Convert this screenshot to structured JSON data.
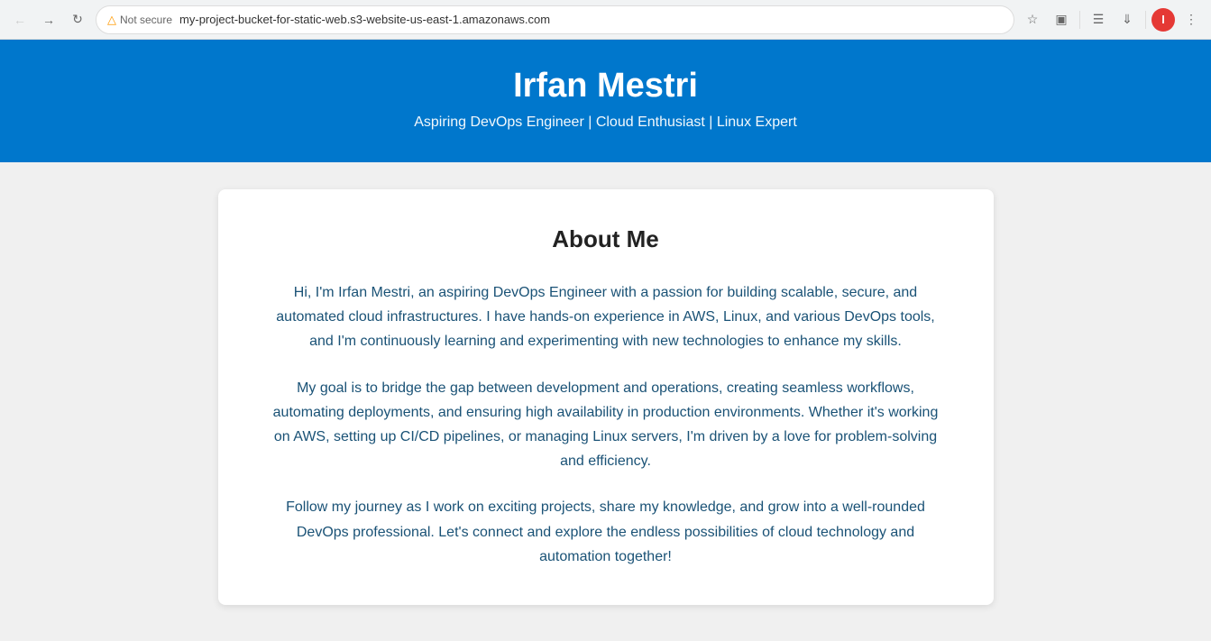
{
  "browser": {
    "not_secure_label": "Not secure",
    "address": "my-project-bucket-for-static-web.s3-website-us-east-1.amazonaws.com"
  },
  "header": {
    "title": "Irfan Mestri",
    "subtitle": "Aspiring DevOps Engineer | Cloud Enthusiast | Linux Expert"
  },
  "main": {
    "section_title": "About Me",
    "paragraph1": "Hi, I'm Irfan Mestri, an aspiring DevOps Engineer with a passion for building scalable, secure, and automated cloud infrastructures. I have hands-on experience in AWS, Linux, and various DevOps tools, and I'm continuously learning and experimenting with new technologies to enhance my skills.",
    "paragraph2": "My goal is to bridge the gap between development and operations, creating seamless workflows, automating deployments, and ensuring high availability in production environments. Whether it's working on AWS, setting up CI/CD pipelines, or managing Linux servers, I'm driven by a love for problem-solving and efficiency.",
    "paragraph3": "Follow my journey as I work on exciting projects, share my knowledge, and grow into a well-rounded DevOps professional. Let's connect and explore the endless possibilities of cloud technology and automation together!"
  }
}
